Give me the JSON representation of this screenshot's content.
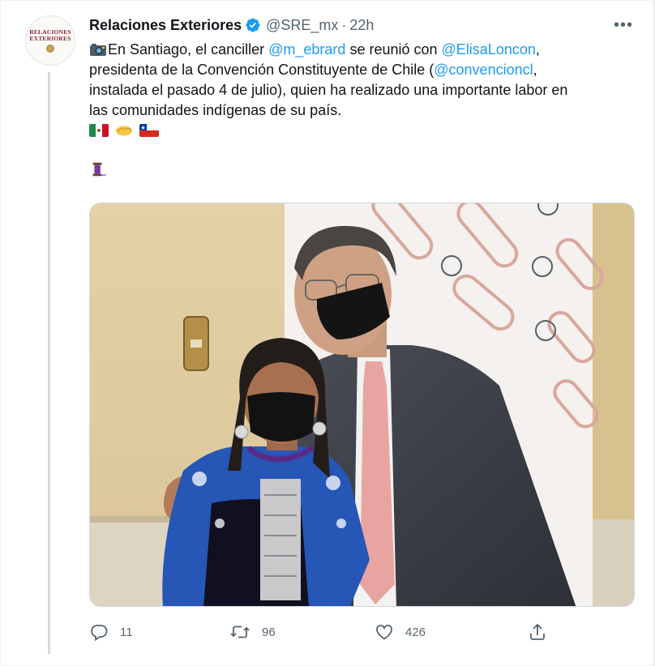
{
  "account": {
    "name": "Relaciones Exteriores",
    "handle": "@SRE_mx",
    "separator": "·",
    "time": "22h",
    "avatar_line1": "RELACIONES",
    "avatar_line2": "EXTERIORES"
  },
  "tweet": {
    "line1_a": "En Santiago, el canciller ",
    "mention1": "@m_ebrard",
    "line1_b": " se reunió con ",
    "mention2": "@ElisaLoncon",
    "line1_c": ",",
    "line2_a": "presidenta de la Convención Constituyente de Chile (",
    "mention3": "@convencioncl",
    "line2_b": ",",
    "line3": "instalada el pasado 4 de julio), quien ha realizado una importante labor en",
    "line4": "las comunidades indígenas de su país."
  },
  "actions": {
    "replies": "11",
    "retweets": "96",
    "likes": "426"
  },
  "icons": {
    "verified": "verified-badge-icon",
    "more": "more-icon",
    "reply": "reply-icon",
    "retweet": "retweet-icon",
    "like": "heart-icon",
    "share": "share-icon"
  },
  "colors": {
    "link": "#1d9bf0",
    "muted": "#536471",
    "text": "#0f1419"
  }
}
